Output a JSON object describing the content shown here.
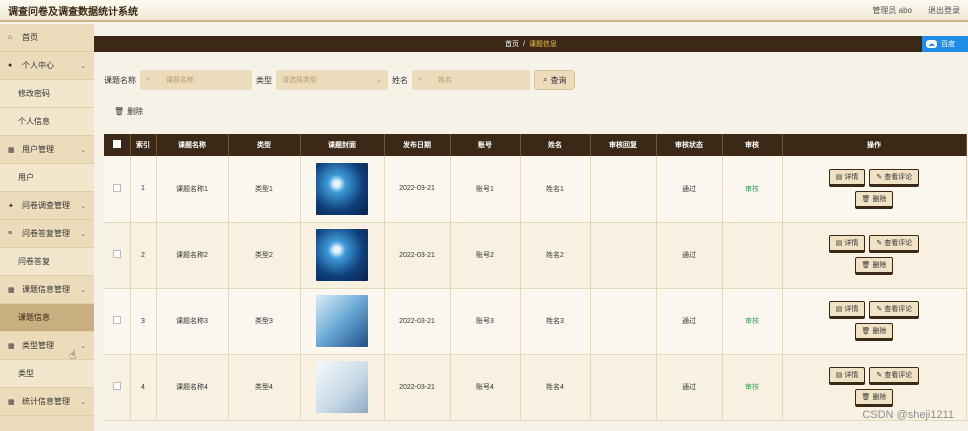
{
  "app_title": "调查问卷及调查数据统计系统",
  "top_links": [
    "管理员 abo",
    "退出登录"
  ],
  "sidebar": {
    "items": [
      {
        "icon": "home-icon",
        "glyph": "⌂",
        "label": "首页",
        "kind": "main"
      },
      {
        "icon": "user-icon",
        "glyph": "●",
        "label": "个人中心",
        "kind": "main",
        "chev": "⌄"
      },
      {
        "label": "修改密码",
        "kind": "sub"
      },
      {
        "label": "个人信息",
        "kind": "sub"
      },
      {
        "icon": "grid-icon",
        "glyph": "▦",
        "label": "用户管理",
        "kind": "main",
        "chev": "⌄"
      },
      {
        "label": "用户",
        "kind": "sub"
      },
      {
        "icon": "survey-icon",
        "glyph": "✦",
        "label": "问卷调查管理",
        "kind": "main",
        "chev": "⌄"
      },
      {
        "icon": "answer-icon",
        "glyph": "≡",
        "label": "问卷答复管理",
        "kind": "main",
        "chev": "⌄"
      },
      {
        "label": "问卷答复",
        "kind": "sub"
      },
      {
        "icon": "grid-icon",
        "glyph": "▦",
        "label": "课题信息管理",
        "kind": "main",
        "chev": "⌄"
      },
      {
        "label": "课题信息",
        "kind": "sub",
        "active": true
      },
      {
        "icon": "type-icon",
        "glyph": "▦",
        "label": "类型管理",
        "kind": "main",
        "chev": "⌄"
      },
      {
        "label": "类型",
        "kind": "sub"
      },
      {
        "icon": "stats-icon",
        "glyph": "▦",
        "label": "统计信息管理",
        "kind": "main",
        "chev": "⌄"
      }
    ]
  },
  "breadcrumb": {
    "home": "首页",
    "sep": "/",
    "current": "课题信息"
  },
  "cloud_badge": "百度",
  "search": {
    "name_label": "课题名称",
    "name_placeholder": "课题名称",
    "type_label": "类型",
    "type_placeholder": "请选择类型",
    "person_label": "姓名",
    "person_placeholder": "姓名",
    "query_button": "查询"
  },
  "delete_all_label": "删除",
  "table": {
    "headers": [
      "",
      "索引",
      "课题名称",
      "类型",
      "课题封面",
      "发布日期",
      "账号",
      "姓名",
      "审核回复",
      "审核状态",
      "审核",
      "操作"
    ],
    "rows": [
      {
        "index": "1",
        "name": "课题名称1",
        "type": "类型1",
        "thumb": "net",
        "date": "2022-03-21",
        "account": "账号1",
        "person": "姓名1",
        "reply": "",
        "status": "通过",
        "audit": "审核"
      },
      {
        "index": "2",
        "name": "课题名称2",
        "type": "类型2",
        "thumb": "net",
        "date": "2022-03-21",
        "account": "账号2",
        "person": "姓名2",
        "reply": "",
        "status": "通过",
        "audit": ""
      },
      {
        "index": "3",
        "name": "课题名称3",
        "type": "类型3",
        "thumb": "dna",
        "date": "2022-03-21",
        "account": "账号3",
        "person": "姓名3",
        "reply": "",
        "status": "通过",
        "audit": "审核"
      },
      {
        "index": "4",
        "name": "课题名称4",
        "type": "类型4",
        "thumb": "lab",
        "date": "2022-03-21",
        "account": "账号4",
        "person": "姓名4",
        "reply": "",
        "status": "通过",
        "audit": "审核"
      }
    ],
    "ops": {
      "detail": "详情",
      "review": "查看评论",
      "delete": "删除"
    }
  },
  "watermark": "CSDN @sheji1211"
}
